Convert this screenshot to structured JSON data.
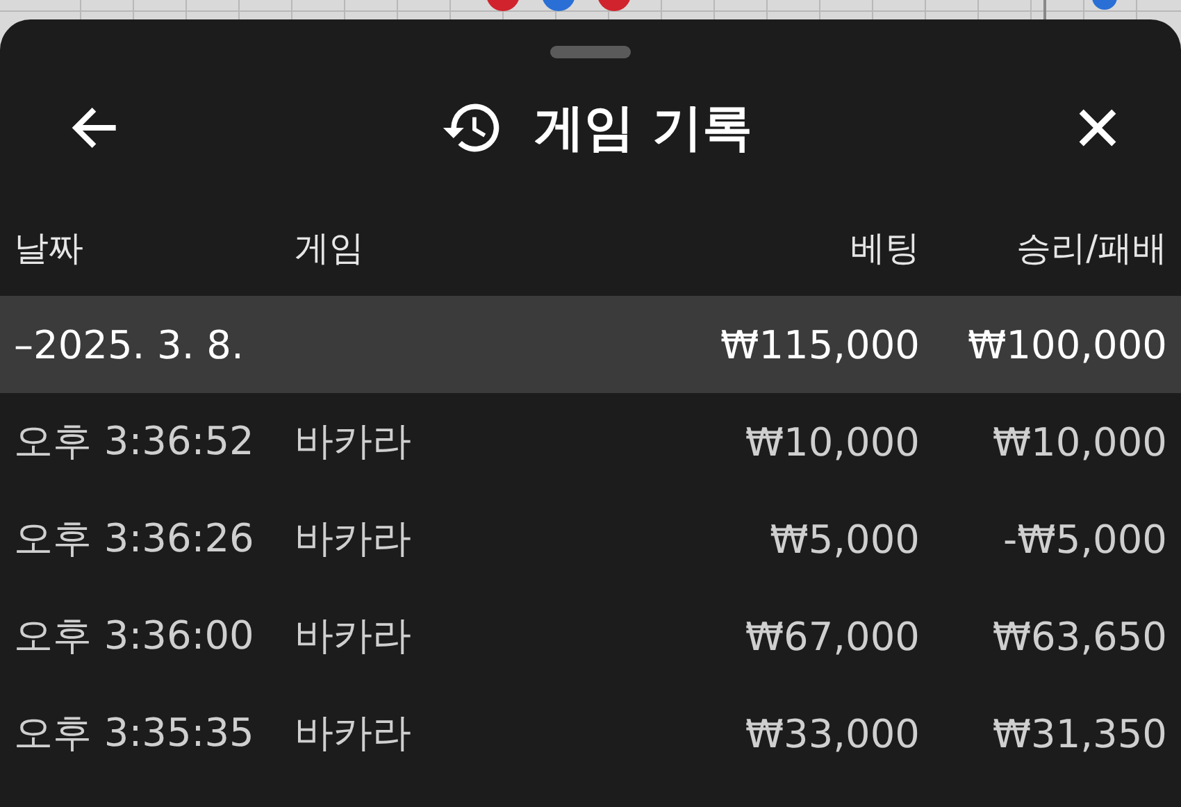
{
  "sheet": {
    "title": "게임 기록"
  },
  "table": {
    "columns": [
      "날짜",
      "게임",
      "베팅",
      "승리/패배"
    ],
    "groups": [
      {
        "date": "–2025. 3. 8.",
        "bet": "₩115,000",
        "result": "₩100,000",
        "expanded": true,
        "rows": [
          {
            "time": "오후 3:36:52",
            "game": "바카라",
            "bet": "₩10,000",
            "result": "₩10,000"
          },
          {
            "time": "오후 3:36:26",
            "game": "바카라",
            "bet": "₩5,000",
            "result": "-₩5,000"
          },
          {
            "time": "오후 3:36:00",
            "game": "바카라",
            "bet": "₩67,000",
            "result": "₩63,650"
          },
          {
            "time": "오후 3:35:35",
            "game": "바카라",
            "bet": "₩33,000",
            "result": "₩31,350"
          }
        ]
      }
    ]
  }
}
